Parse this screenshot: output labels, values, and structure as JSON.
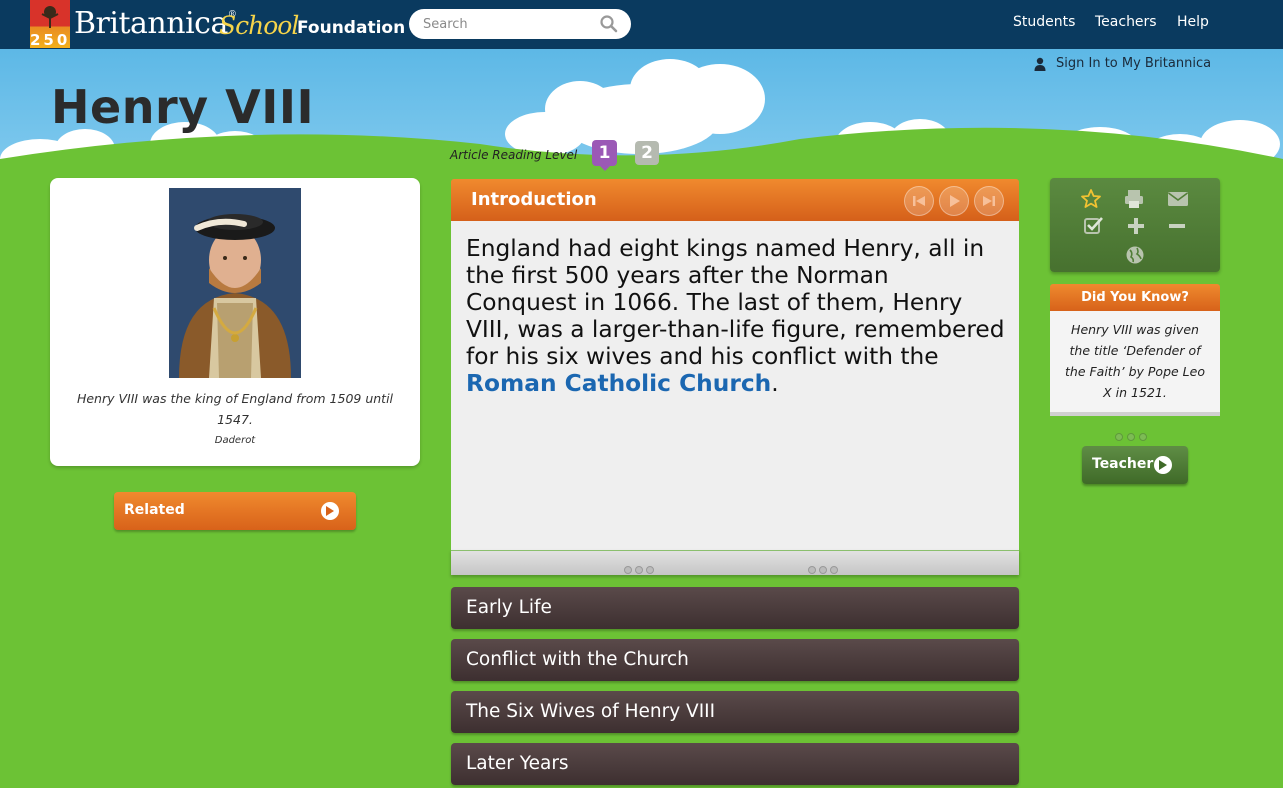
{
  "header": {
    "logo_number": "250",
    "brand_name": "Britannica",
    "brand_reg": "®",
    "brand_school": "School",
    "edition": "Foundation",
    "search_placeholder": "Search",
    "nav": [
      "Students",
      "Teachers",
      "Help"
    ]
  },
  "account": {
    "sign_in": "Sign In to My Britannica"
  },
  "article": {
    "title": "Henry VIII",
    "reading_level_label": "Article Reading Level",
    "reading_levels": [
      "1",
      "2"
    ],
    "selected_level": "1",
    "image": {
      "caption": "Henry VIII was the king of England from 1509 until 1547.",
      "credit": "Daderot"
    },
    "related_label": "Related",
    "intro": {
      "title": "Introduction",
      "text_before_link": "England had eight kings named Henry, all in the first 500 years after the Norman Conquest in 1066. The last of them, Henry VIII, was a larger-than-life figure, remembered for his six wives and his conflict with the ",
      "link_text": "Roman Catholic Church",
      "text_after_link": "."
    },
    "sections": [
      "Early Life",
      "Conflict with the Church",
      "The Six Wives of Henry VIII",
      "Later Years"
    ]
  },
  "sidebar": {
    "tools": [
      "star-icon",
      "print-icon",
      "email-icon",
      "check-icon",
      "zoom-in-icon",
      "zoom-out-icon",
      "globe-icon"
    ],
    "did_you_know": {
      "title": "Did You Know?",
      "text": "Henry VIII was given the title ‘Defender of the Faith’ by Pope Leo X in 1521."
    },
    "teacher_label": "Teacher"
  },
  "colors": {
    "nav_bg": "#0a3a5f",
    "grass": "#6cc235",
    "accent_orange": "#e07522",
    "section_brown": "#4a3c3d",
    "link_blue": "#1b67b1",
    "level_purple": "#9b59b6",
    "tool_green": "#527e38"
  }
}
